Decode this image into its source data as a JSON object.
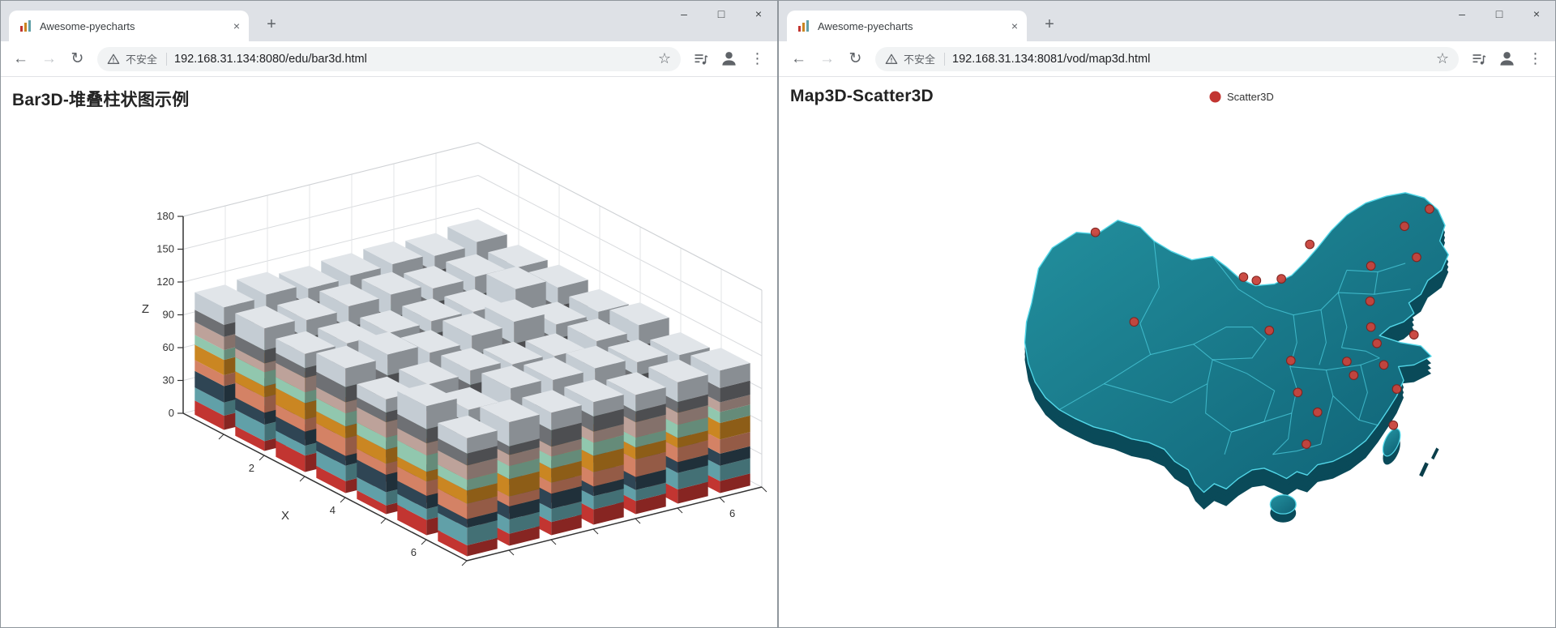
{
  "glyphs": {
    "back": "←",
    "forward": "→",
    "reload": "↻",
    "star": "☆",
    "minimize": "–",
    "maximize": "□",
    "close": "×",
    "tab_close": "×",
    "plus": "+",
    "kebab": "⋮"
  },
  "windows": [
    {
      "tab_title": "Awesome-pyecharts",
      "security_text": "不安全",
      "url": "192.168.31.134:8080/edu/bar3d.html",
      "page_title": "Bar3D-堆叠柱状图示例"
    },
    {
      "tab_title": "Awesome-pyecharts",
      "security_text": "不安全",
      "url": "192.168.31.134:8081/vod/map3d.html",
      "page_title": "Map3D-Scatter3D",
      "legend": {
        "label": "Scatter3D",
        "color": "#c23531"
      }
    }
  ],
  "chart_data": [
    {
      "type": "bar",
      "subtype": "bar3d-stacked",
      "title": "Bar3D-堆叠柱状图示例",
      "axis_labels": {
        "x": "X",
        "z": "Z"
      },
      "x_ticks": [
        2,
        4,
        6
      ],
      "y_ticks": [
        6
      ],
      "z_ticks": [
        0,
        30,
        60,
        90,
        120,
        150,
        180
      ],
      "zlim": [
        0,
        180
      ],
      "grid_size": [
        7,
        7
      ],
      "series_colors": [
        "#c23531",
        "#61a0a8",
        "#2f4554",
        "#d48265",
        "#ca8622",
        "#91c7ae",
        "#bda29a",
        "#6e7074",
        "#c4ccd3"
      ],
      "stacks": [
        [
          [
            13,
            12,
            15,
            10,
            14,
            9,
            12,
            11,
            16
          ],
          [
            9,
            15,
            11,
            14,
            10,
            13,
            8,
            12,
            20
          ],
          [
            15,
            9,
            13,
            11,
            15,
            10,
            13,
            9,
            13
          ],
          [
            11,
            14,
            9,
            16,
            11,
            12,
            10,
            14,
            17
          ],
          [
            8,
            12,
            16,
            10,
            13,
            11,
            14,
            9,
            12
          ],
          [
            14,
            10,
            12,
            13,
            9,
            15,
            11,
            13,
            21
          ],
          [
            10,
            16,
            8,
            14,
            12,
            10,
            13,
            11,
            14
          ]
        ],
        [
          [
            12,
            11,
            14,
            13,
            10,
            12,
            15,
            9,
            18
          ],
          [
            14,
            13,
            9,
            11,
            15,
            14,
            8,
            10,
            16
          ],
          [
            9,
            16,
            12,
            8,
            13,
            11,
            14,
            12,
            13
          ],
          [
            13,
            9,
            15,
            12,
            11,
            14,
            9,
            15,
            19
          ],
          [
            10,
            14,
            11,
            16,
            8,
            13,
            12,
            10,
            15
          ],
          [
            16,
            10,
            8,
            12,
            14,
            9,
            11,
            13,
            12
          ],
          [
            11,
            13,
            12,
            9,
            16,
            12,
            10,
            8,
            22
          ]
        ],
        [
          [
            15,
            10,
            13,
            12,
            9,
            14,
            11,
            12,
            14
          ],
          [
            10,
            14,
            12,
            9,
            13,
            10,
            15,
            11,
            19
          ],
          [
            13,
            11,
            15,
            14,
            10,
            12,
            8,
            13,
            12
          ],
          [
            9,
            13,
            10,
            15,
            12,
            9,
            14,
            10,
            17
          ],
          [
            14,
            9,
            12,
            11,
            16,
            13,
            10,
            14,
            13
          ],
          [
            11,
            15,
            9,
            13,
            10,
            16,
            12,
            9,
            20
          ],
          [
            12,
            12,
            14,
            10,
            13,
            11,
            9,
            15,
            16
          ]
        ],
        [
          [
            10,
            13,
            11,
            15,
            12,
            10,
            14,
            12,
            15
          ],
          [
            13,
            9,
            14,
            12,
            10,
            15,
            11,
            9,
            21
          ],
          [
            11,
            15,
            10,
            13,
            14,
            8,
            12,
            14,
            12
          ],
          [
            16,
            10,
            13,
            9,
            11,
            13,
            15,
            10,
            18
          ],
          [
            9,
            14,
            12,
            14,
            13,
            11,
            8,
            13,
            14
          ],
          [
            12,
            11,
            16,
            10,
            9,
            14,
            13,
            11,
            17
          ],
          [
            14,
            12,
            9,
            13,
            15,
            12,
            10,
            14,
            13
          ]
        ],
        [
          [
            11,
            14,
            10,
            12,
            13,
            15,
            9,
            10,
            19
          ],
          [
            15,
            10,
            13,
            14,
            9,
            11,
            12,
            13,
            13
          ],
          [
            9,
            12,
            15,
            10,
            14,
            13,
            11,
            8,
            16
          ],
          [
            13,
            15,
            9,
            12,
            10,
            14,
            13,
            12,
            20
          ],
          [
            10,
            9,
            14,
            13,
            12,
            10,
            15,
            11,
            12
          ],
          [
            14,
            13,
            11,
            9,
            15,
            12,
            8,
            14,
            18
          ],
          [
            12,
            10,
            12,
            16,
            11,
            9,
            14,
            10,
            15
          ]
        ],
        [
          [
            13,
            11,
            9,
            14,
            10,
            13,
            12,
            15,
            14
          ],
          [
            9,
            13,
            14,
            10,
            12,
            15,
            10,
            11,
            17
          ],
          [
            14,
            10,
            12,
            13,
            15,
            9,
            13,
            12,
            21
          ],
          [
            10,
            14,
            11,
            9,
            13,
            12,
            15,
            9,
            13
          ],
          [
            15,
            9,
            13,
            12,
            8,
            14,
            10,
            13,
            16
          ],
          [
            11,
            12,
            15,
            10,
            14,
            10,
            12,
            14,
            12
          ],
          [
            13,
            15,
            10,
            13,
            9,
            12,
            11,
            10,
            18
          ]
        ],
        [
          [
            12,
            9,
            13,
            11,
            14,
            12,
            10,
            13,
            20
          ],
          [
            14,
            12,
            10,
            15,
            9,
            13,
            14,
            9,
            14
          ],
          [
            10,
            15,
            12,
            9,
            13,
            11,
            9,
            15,
            17
          ],
          [
            15,
            11,
            14,
            12,
            10,
            9,
            13,
            11,
            13
          ],
          [
            9,
            13,
            10,
            14,
            12,
            15,
            11,
            12,
            19
          ],
          [
            13,
            10,
            15,
            9,
            11,
            13,
            14,
            10,
            12
          ],
          [
            11,
            14,
            11,
            13,
            15,
            10,
            9,
            13,
            16
          ]
        ]
      ]
    },
    {
      "type": "scatter",
      "subtype": "map3d-china-scatter3d",
      "title": "Map3D-Scatter3D",
      "legend": [
        "Scatter3D"
      ],
      "colors": {
        "surface_from": "#23919f",
        "surface_to": "#0f6175",
        "side": "#0a4a59",
        "border": "#52d7e8",
        "point": "#c8423b"
      },
      "points": [
        [
          170,
          86
        ],
        [
          342,
          138
        ],
        [
          386,
          140
        ],
        [
          357,
          142
        ],
        [
          419,
          100
        ],
        [
          529,
          79
        ],
        [
          558,
          59
        ],
        [
          490,
          125
        ],
        [
          543,
          115
        ],
        [
          489,
          166
        ],
        [
          490,
          196
        ],
        [
          540,
          205
        ],
        [
          497,
          215
        ],
        [
          372,
          200
        ],
        [
          215,
          190
        ],
        [
          397,
          235
        ],
        [
          462,
          236
        ],
        [
          505,
          240
        ],
        [
          470,
          252
        ],
        [
          405,
          272
        ],
        [
          428,
          295
        ],
        [
          520,
          268
        ],
        [
          415,
          332
        ],
        [
          516,
          310
        ]
      ]
    }
  ]
}
